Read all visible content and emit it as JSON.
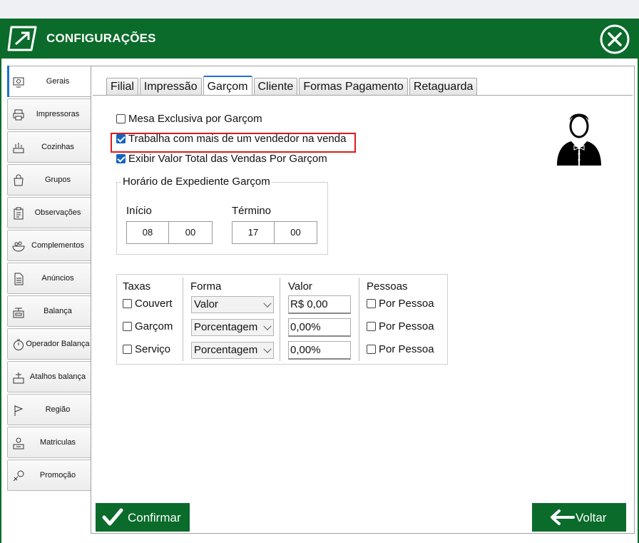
{
  "window": {
    "title": "CONFIGURAÇÕES"
  },
  "sidebar": {
    "items": [
      {
        "label": "Gerais",
        "icon": "settings-monitor-icon",
        "active": true
      },
      {
        "label": "Impressoras",
        "icon": "printer-icon"
      },
      {
        "label": "Cozinhas",
        "icon": "kitchen-icon"
      },
      {
        "label": "Grupos",
        "icon": "shopping-bag-icon"
      },
      {
        "label": "Observações",
        "icon": "clipboard-icon"
      },
      {
        "label": "Complementos",
        "icon": "bowl-icon"
      },
      {
        "label": "Anúncios",
        "icon": "document-icon"
      },
      {
        "label": "Balança",
        "icon": "scale-icon"
      },
      {
        "label": "Operador Balança",
        "icon": "stopwatch-icon"
      },
      {
        "label": "Atalhos balança",
        "icon": "scale-shortcut-icon"
      },
      {
        "label": "Região",
        "icon": "flag-icon"
      },
      {
        "label": "Matriculas",
        "icon": "registration-icon"
      },
      {
        "label": "Promoção",
        "icon": "promotion-icon"
      }
    ]
  },
  "tabs": [
    "Filial",
    "Impressão",
    "Garçom",
    "Cliente",
    "Formas Pagamento",
    "Retaguarda"
  ],
  "active_tab": "Garçom",
  "options": {
    "mesa_exclusiva": {
      "label": "Mesa Exclusiva por Garçom",
      "checked": false
    },
    "mais_vendedor": {
      "label": "Trabalha com mais de um vendedor na venda",
      "checked": true
    },
    "exibir_valor": {
      "label": "Exibir Valor Total das Vendas Por Garçom",
      "checked": true
    }
  },
  "schedule": {
    "title": "Horário de Expediente Garçom",
    "start_label": "Início",
    "start_hour": "08",
    "start_min": "00",
    "end_label": "Término",
    "end_hour": "17",
    "end_min": "00"
  },
  "fees": {
    "headers": {
      "taxas": "Taxas",
      "forma": "Forma",
      "valor": "Valor",
      "pessoas": "Pessoas"
    },
    "rows": [
      {
        "name": "Couvert",
        "checked": false,
        "forma": "Valor",
        "valor": "R$ 0,00",
        "pessoa_label": "Por Pessoa",
        "pessoa_checked": false
      },
      {
        "name": "Garçom",
        "checked": false,
        "forma": "Porcentagem",
        "valor": "0,00%",
        "pessoa_label": "Por Pessoa",
        "pessoa_checked": false
      },
      {
        "name": "Serviço",
        "checked": false,
        "forma": "Porcentagem",
        "valor": "0,00%",
        "pessoa_label": "Por Pessoa",
        "pessoa_checked": false
      }
    ]
  },
  "buttons": {
    "confirm": "Confirmar",
    "back": "Voltar"
  },
  "colors": {
    "brand_green": "#0a6b2a",
    "accent_blue": "#1f6fd1",
    "highlight_red": "#e01b1b"
  }
}
